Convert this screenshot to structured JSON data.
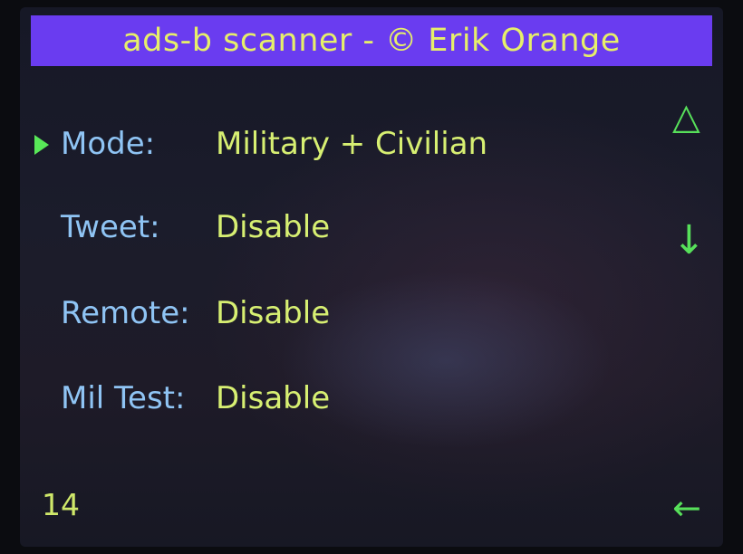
{
  "header": {
    "title": "ads-b scanner - © Erik Orange"
  },
  "menu": {
    "items": [
      {
        "label": "Mode:",
        "value": "Military + Civilian",
        "selected": true
      },
      {
        "label": "Tweet:",
        "value": "Disable",
        "selected": false
      },
      {
        "label": "Remote:",
        "value": "Disable",
        "selected": false
      },
      {
        "label": "Mil Test:",
        "value": "Disable",
        "selected": false
      }
    ]
  },
  "navigation": {
    "up_glyph": "△",
    "down_glyph": "↓",
    "back_glyph": "←"
  },
  "footer": {
    "page_number": "14"
  },
  "colors": {
    "title_bar": "#6a3cf0",
    "title_text": "#e6ef6a",
    "label_text": "#8fc4f4",
    "value_text": "#d7ef72",
    "icon_green": "#57e05a"
  },
  "icons": {
    "selection": "selection-pointer-icon",
    "up": "up-triangle-icon",
    "down": "down-arrow-icon",
    "back": "back-arrow-icon"
  }
}
